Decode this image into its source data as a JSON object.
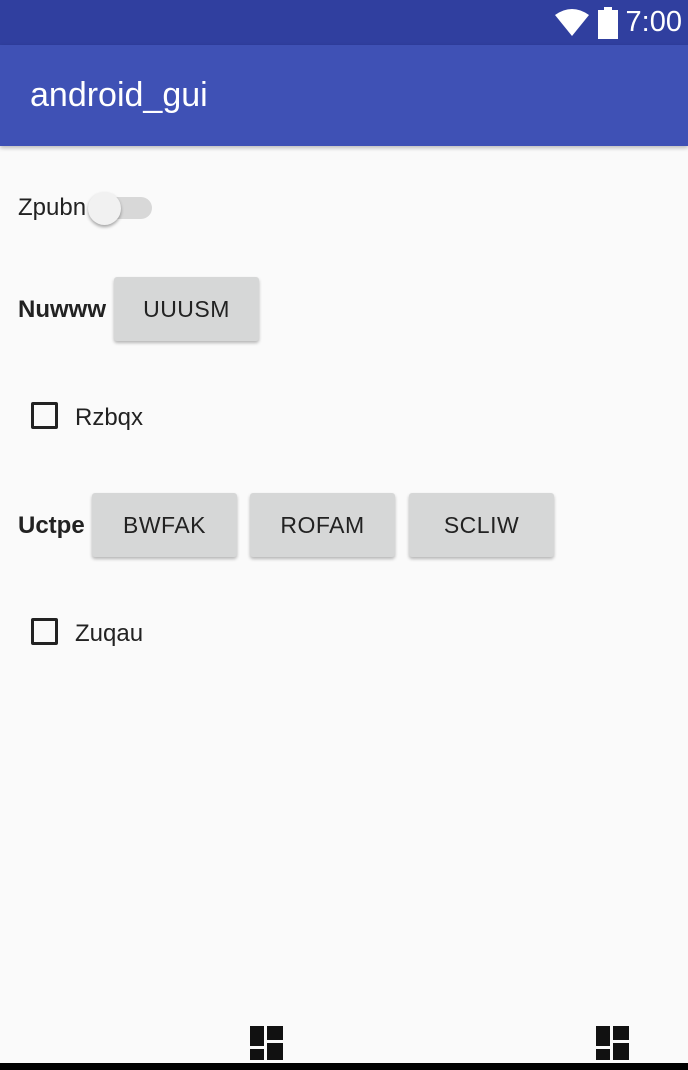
{
  "status_bar": {
    "time": "7:00",
    "icons": [
      "wifi-icon",
      "battery-icon"
    ]
  },
  "app_bar": {
    "title": "android_gui"
  },
  "rows": {
    "switch_row": {
      "label": "Zpubn",
      "checked": false
    },
    "button_row_1": {
      "label": "Nuwww",
      "buttons": [
        "UUUSM"
      ]
    },
    "checkbox_1": {
      "label": "Rzbqx",
      "checked": false
    },
    "button_row_2": {
      "label": "Uctpe",
      "buttons": [
        "BWFAK",
        "ROFAM",
        "SCLIW"
      ]
    },
    "checkbox_2": {
      "label": "Zuqau",
      "checked": false
    }
  },
  "bottom": {
    "icons": [
      "dashboard-icon",
      "dashboard-icon"
    ]
  },
  "colors": {
    "status_bar": "#303f9f",
    "app_bar": "#3f51b5",
    "background": "#fafafa",
    "button": "#d6d7d7"
  }
}
